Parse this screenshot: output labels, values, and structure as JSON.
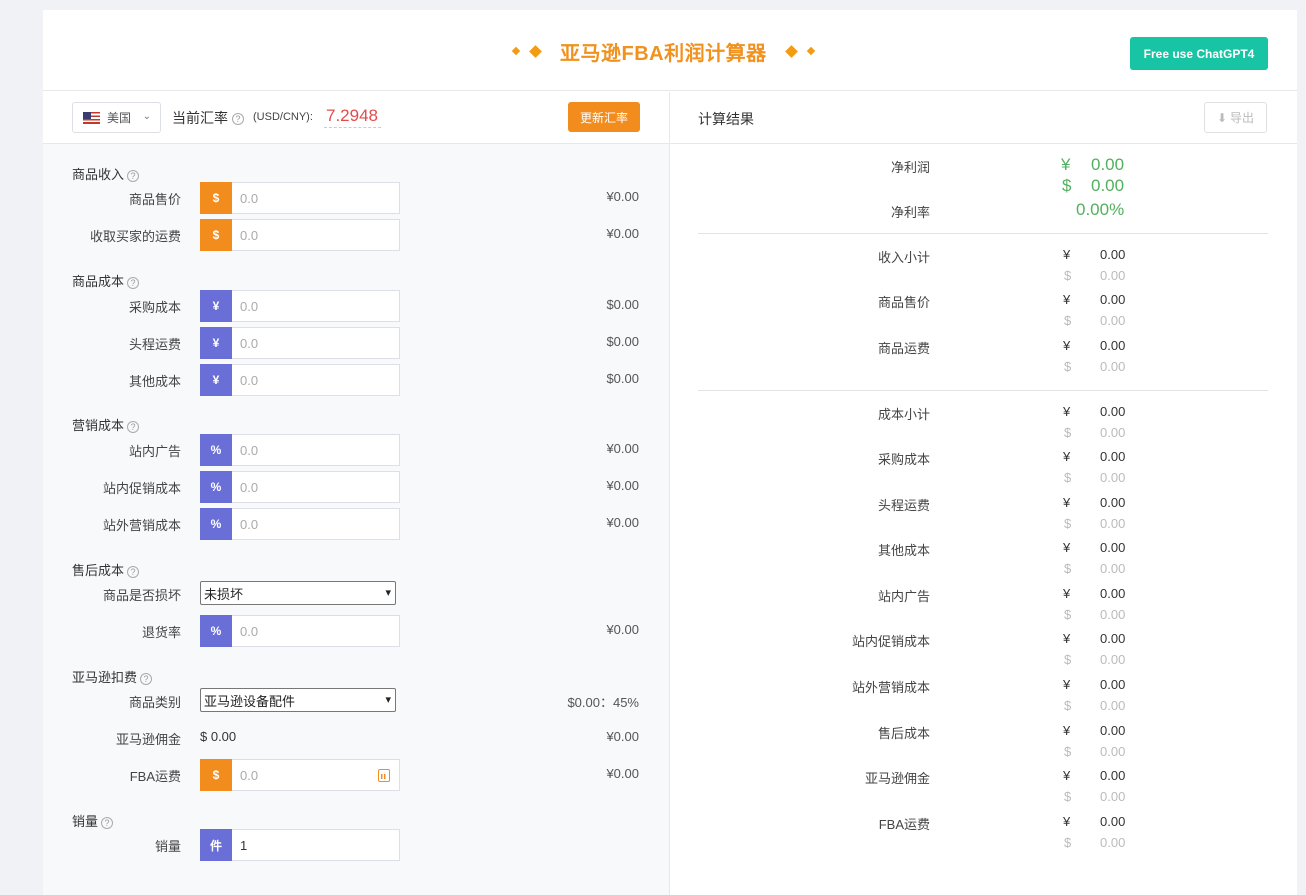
{
  "header": {
    "title": "亚马逊FBA利润计算器",
    "chatgpt_button": "Free use ChatGPT4",
    "accent_color": "#f0921d",
    "button_color": "#17c5a4"
  },
  "toolbar": {
    "country": "美国",
    "rate_label": "当前汇率",
    "rate_unit": "(USD/CNY):",
    "rate_value": "7.2948",
    "update_button": "更新汇率"
  },
  "form": {
    "sections": {
      "income": "商品收入",
      "cost": "商品成本",
      "marketing": "营销成本",
      "aftersale": "售后成本",
      "amazon_fee": "亚马逊扣费",
      "sales": "销量"
    },
    "rows": {
      "price": {
        "label": "商品售价",
        "addon": "$",
        "placeholder": "0.0",
        "value": "¥0.00"
      },
      "buyer_shipping": {
        "label": "收取买家的运费",
        "addon": "$",
        "placeholder": "0.0",
        "value": "¥0.00"
      },
      "purchase": {
        "label": "采购成本",
        "addon": "¥",
        "placeholder": "0.0",
        "value": "$0.00"
      },
      "first_leg": {
        "label": "头程运费",
        "addon": "¥",
        "placeholder": "0.0",
        "value": "$0.00"
      },
      "other_cost": {
        "label": "其他成本",
        "addon": "¥",
        "placeholder": "0.0",
        "value": "$0.00"
      },
      "onsite_ads": {
        "label": "站内广告",
        "addon": "%",
        "placeholder": "0.0",
        "value": "¥0.00"
      },
      "onsite_promo": {
        "label": "站内促销成本",
        "addon": "%",
        "placeholder": "0.0",
        "value": "¥0.00"
      },
      "offsite_marketing": {
        "label": "站外营销成本",
        "addon": "%",
        "placeholder": "0.0",
        "value": "¥0.00"
      },
      "damaged": {
        "label": "商品是否损坏",
        "selected": "未损坏"
      },
      "return_rate": {
        "label": "退货率",
        "addon": "%",
        "placeholder": "0.0",
        "value": "¥0.00"
      },
      "category": {
        "label": "商品类别",
        "selected": "亚马逊设备配件",
        "value": "$0.00：45%"
      },
      "commission": {
        "label": "亚马逊佣金",
        "amount": "$ 0.00",
        "value": "¥0.00"
      },
      "fba_fee": {
        "label": "FBA运费",
        "addon": "$",
        "placeholder": "0.0",
        "value": "¥0.00"
      },
      "quantity": {
        "label": "销量",
        "addon": "件",
        "value": "1"
      }
    }
  },
  "results": {
    "title": "计算结果",
    "export_button": "导出",
    "net_profit": {
      "label": "净利润",
      "cny_symbol": "¥",
      "cny": "0.00",
      "usd_symbol": "$",
      "usd": "0.00"
    },
    "net_margin": {
      "label": "净利率",
      "value": "0.00%"
    },
    "lines": [
      {
        "label": "收入小计",
        "cny": "0.00",
        "usd": "0.00"
      },
      {
        "label": "商品售价",
        "cny": "0.00",
        "usd": "0.00"
      },
      {
        "label": "商品运费",
        "cny": "0.00",
        "usd": "0.00"
      },
      {
        "label": "成本小计",
        "cny": "0.00",
        "usd": "0.00"
      },
      {
        "label": "采购成本",
        "cny": "0.00",
        "usd": "0.00"
      },
      {
        "label": "头程运费",
        "cny": "0.00",
        "usd": "0.00"
      },
      {
        "label": "其他成本",
        "cny": "0.00",
        "usd": "0.00"
      },
      {
        "label": "站内广告",
        "cny": "0.00",
        "usd": "0.00"
      },
      {
        "label": "站内促销成本",
        "cny": "0.00",
        "usd": "0.00"
      },
      {
        "label": "站外营销成本",
        "cny": "0.00",
        "usd": "0.00"
      },
      {
        "label": "售后成本",
        "cny": "0.00",
        "usd": "0.00"
      },
      {
        "label": "亚马逊佣金",
        "cny": "0.00",
        "usd": "0.00"
      },
      {
        "label": "FBA运费",
        "cny": "0.00",
        "usd": "0.00"
      }
    ],
    "cny_symbol": "¥",
    "usd_symbol": "$"
  }
}
